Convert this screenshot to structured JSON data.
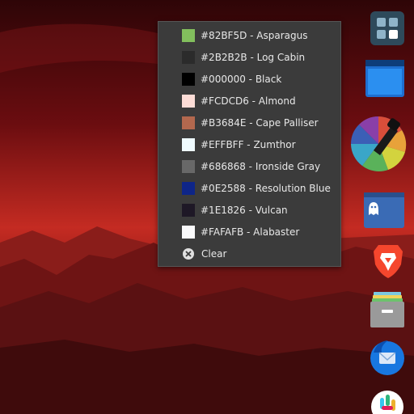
{
  "menu": {
    "items": [
      {
        "hex": "#82BF5D",
        "label": "#82BF5D - Asparagus"
      },
      {
        "hex": "#2B2B2B",
        "label": "#2B2B2B - Log Cabin"
      },
      {
        "hex": "#000000",
        "label": "#000000 - Black"
      },
      {
        "hex": "#FCDCD6",
        "label": "#FCDCD6 - Almond"
      },
      {
        "hex": "#B3684E",
        "label": "#B3684E - Cape Palliser"
      },
      {
        "hex": "#EFFBFF",
        "label": "#EFFBFF - Zumthor"
      },
      {
        "hex": "#686868",
        "label": "#686868 - Ironside Gray"
      },
      {
        "hex": "#0E2588",
        "label": "#0E2588 - Resolution Blue"
      },
      {
        "hex": "#1E1826",
        "label": "#1E1826 - Vulcan"
      },
      {
        "hex": "#FAFAFB",
        "label": "#FAFAFB - Alabaster"
      }
    ],
    "clear_label": "Clear"
  },
  "dock": {
    "icons": [
      "app-grid-icon",
      "files-window-icon",
      "color-picker-icon",
      "ghost-app-icon",
      "brave-browser-icon",
      "archive-icon",
      "thunderbird-icon",
      "slack-icon"
    ]
  }
}
